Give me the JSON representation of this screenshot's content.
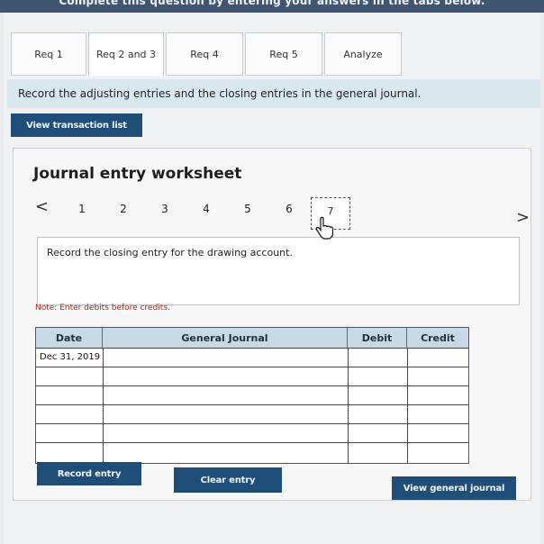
{
  "header": {
    "banner": "Complete this question by entering your answers in the tabs below."
  },
  "tabs": [
    {
      "label": "Req 1"
    },
    {
      "label": "Req 2 and 3"
    },
    {
      "label": "Req 4"
    },
    {
      "label": "Req 5"
    },
    {
      "label": "Analyze"
    }
  ],
  "instruction": "Record the adjusting entries and the closing entries in the general journal.",
  "buttons": {
    "view_transaction_list": "View transaction list",
    "record_entry": "Record entry",
    "clear_entry": "Clear entry",
    "view_general_journal": "View general journal"
  },
  "worksheet": {
    "title": "Journal entry worksheet",
    "nav": {
      "prev": "<",
      "next": ">",
      "pages": [
        "1",
        "2",
        "3",
        "4",
        "5",
        "6",
        "7"
      ],
      "active_page": "7"
    },
    "description": "Record the closing entry for the drawing account.",
    "note": "Note: Enter debits before credits."
  },
  "journal_table": {
    "headers": {
      "date": "Date",
      "general_journal": "General Journal",
      "debit": "Debit",
      "credit": "Credit"
    },
    "rows": [
      {
        "date": "Dec 31, 2019",
        "account": "",
        "debit": "",
        "credit": ""
      },
      {
        "date": "",
        "account": "",
        "debit": "",
        "credit": ""
      },
      {
        "date": "",
        "account": "",
        "debit": "",
        "credit": ""
      },
      {
        "date": "",
        "account": "",
        "debit": "",
        "credit": ""
      },
      {
        "date": "",
        "account": "",
        "debit": "",
        "credit": ""
      },
      {
        "date": "",
        "account": "",
        "debit": "",
        "credit": ""
      }
    ]
  },
  "colors": {
    "accent": "#1f4e79",
    "instruction_bg": "#d9e7ee",
    "table_header": "#c5d9e7",
    "note": "#a3281c"
  },
  "icons": {
    "cursor": "hand-pointer-icon",
    "prev": "chevron-left-icon",
    "next": "chevron-right-icon"
  }
}
